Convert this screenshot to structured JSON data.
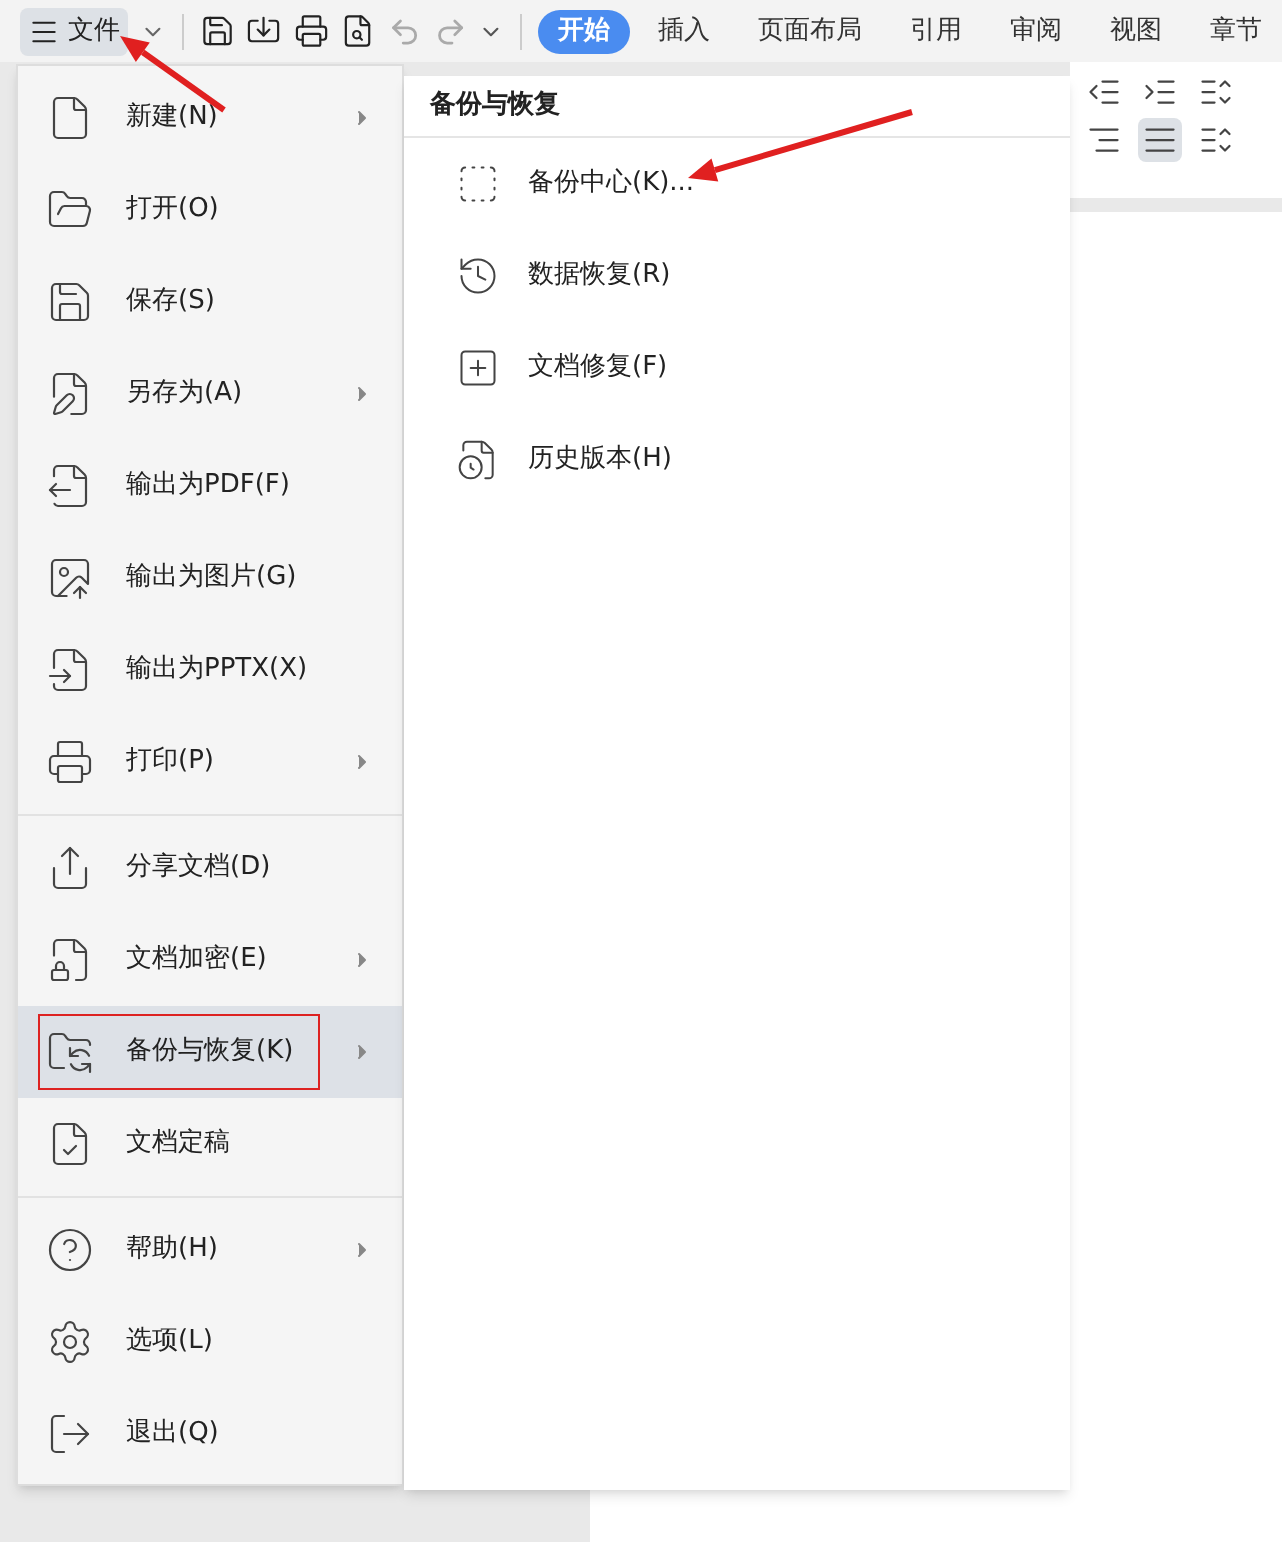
{
  "toolbar": {
    "file_menu": {
      "label": "文件",
      "open": true
    },
    "tabs": [
      {
        "label": "开始",
        "selected": true
      },
      {
        "label": "插入",
        "selected": false
      },
      {
        "label": "页面布局",
        "selected": false
      },
      {
        "label": "引用",
        "selected": false
      },
      {
        "label": "审阅",
        "selected": false
      },
      {
        "label": "视图",
        "selected": false
      },
      {
        "label": "章节",
        "selected": false
      }
    ]
  },
  "file_menu": {
    "groups": [
      [
        {
          "label": "新建(N)",
          "submenu": true,
          "selected": false
        },
        {
          "label": "打开(O)",
          "submenu": false,
          "selected": false
        },
        {
          "label": "保存(S)",
          "submenu": false,
          "selected": false
        },
        {
          "label": "另存为(A)",
          "submenu": true,
          "selected": false
        },
        {
          "label": "输出为PDF(F)",
          "submenu": false,
          "selected": false
        },
        {
          "label": "输出为图片(G)",
          "submenu": false,
          "selected": false
        },
        {
          "label": "输出为PPTX(X)",
          "submenu": false,
          "selected": false
        },
        {
          "label": "打印(P)",
          "submenu": true,
          "selected": false
        }
      ],
      [
        {
          "label": "分享文档(D)",
          "submenu": false,
          "selected": false
        },
        {
          "label": "文档加密(E)",
          "submenu": true,
          "selected": false
        },
        {
          "label": "备份与恢复(K)",
          "submenu": true,
          "selected": true
        },
        {
          "label": "文档定稿",
          "submenu": false,
          "selected": false
        }
      ],
      [
        {
          "label": "帮助(H)",
          "submenu": true,
          "selected": false
        },
        {
          "label": "选项(L)",
          "submenu": false,
          "selected": false
        },
        {
          "label": "退出(Q)",
          "submenu": false,
          "selected": false
        }
      ]
    ]
  },
  "submenu": {
    "title": "备份与恢复",
    "items": [
      {
        "label": "备份中心(K)..."
      },
      {
        "label": "数据恢复(R)"
      },
      {
        "label": "文档修复(F)"
      },
      {
        "label": "历史版本(H)"
      }
    ]
  }
}
